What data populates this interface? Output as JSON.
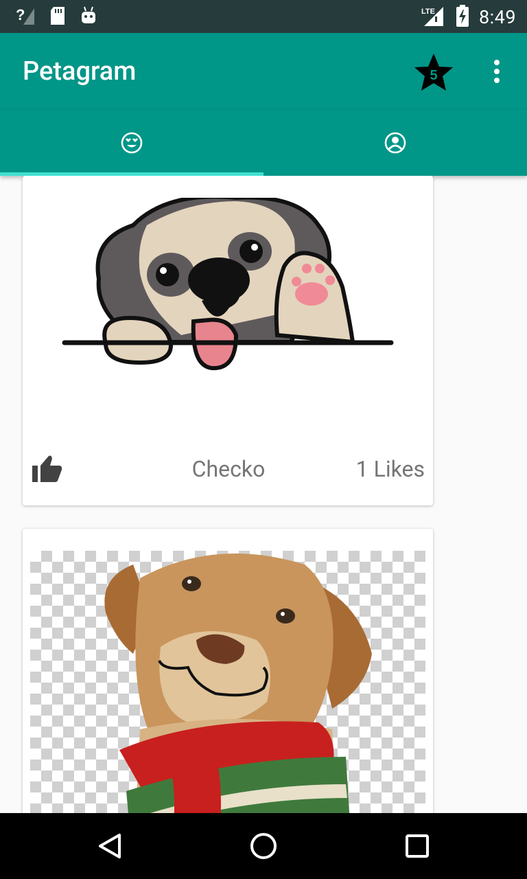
{
  "status_bar": {
    "time": "8:49",
    "icons": [
      "no-signal-icon",
      "sd-card-icon",
      "android-icon",
      "lte-signal-icon",
      "battery-charging-icon"
    ],
    "lte_label": "LTE"
  },
  "app_bar": {
    "title": "Petagram",
    "favorites_badge": "5",
    "icons": [
      "star-icon",
      "more-vert-icon"
    ]
  },
  "tabs": [
    {
      "icon": "heart-eyes-face-icon",
      "selected": true
    },
    {
      "icon": "account-circle-icon",
      "selected": false
    }
  ],
  "pets": [
    {
      "name": "Checko",
      "likes": "1",
      "likes_label": "Likes",
      "image": "pug-puppy-illustration"
    },
    {
      "name": "",
      "likes": "",
      "likes_label": "",
      "image": "dog-with-red-scarf-illustration"
    }
  ],
  "colors": {
    "primary": "#009688",
    "status_bar": "#263b3b",
    "tab_indicator": "#40e0d0",
    "text_secondary": "#757575"
  },
  "nav_bar": {
    "icons": [
      "back-icon",
      "home-icon",
      "recents-icon"
    ]
  }
}
